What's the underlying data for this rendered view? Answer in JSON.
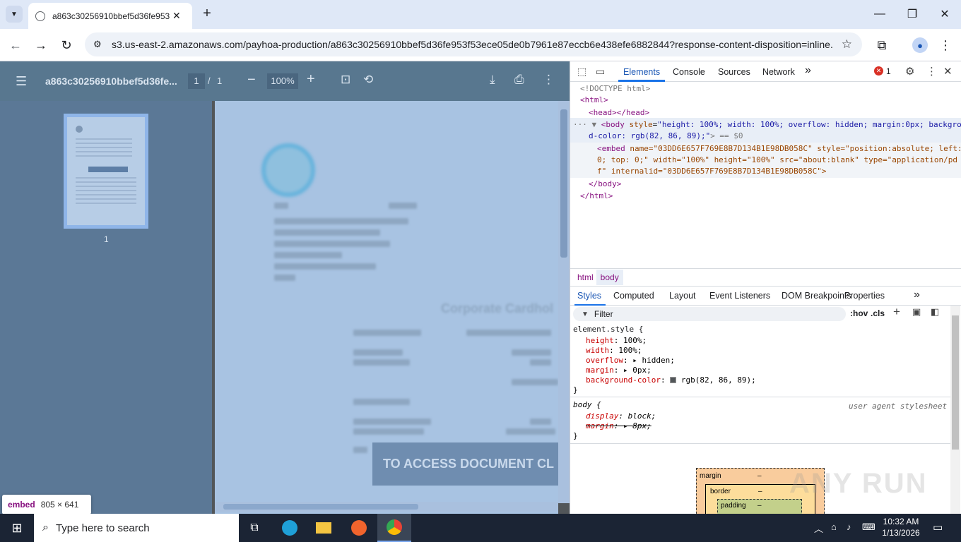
{
  "browser": {
    "tab_title": "a863c30256910bbef5d36fe953",
    "new_tab": "+",
    "url": "s3.us-east-2.amazonaws.com/payhoa-production/a863c30256910bbef5d36fe953f53ece05de0b7961e87eccb6e438efe6882844?response-content-disposition=inline..."
  },
  "pdf": {
    "filename": "a863c30256910bbef5d36fe...",
    "page_current": "1",
    "page_sep": "/",
    "page_total": "1",
    "zoom": "100%",
    "thumb_label": "1",
    "overlay_text": "TO ACCESS DOCUMENT CL",
    "doc_heading": "Corporate Cardhol"
  },
  "embed_tooltip": {
    "tag": "embed",
    "size": "805 × 641"
  },
  "devtools": {
    "tabs": [
      "Elements",
      "Console",
      "Sources",
      "Network"
    ],
    "more": "»",
    "error_count": "1",
    "dom": {
      "doctype": "<!DOCTYPE html>",
      "html_open": "<html>",
      "head": "<head></head>",
      "body_tag": "<body",
      "body_attr": "style",
      "body_val_1": "\"height: 100%; width: 100%; overflow: hidden; margin:0px; backgroun",
      "body_val_2": "d-color: rgb(82, 86, 89);\"",
      "body_end": "> == $0",
      "embed_tag": "<embed",
      "embed_line1": " name=\"03DD6E657F769E8B7D134B1E98DB058C\" style=\"position:absolute; left:",
      "embed_line2": "0; top: 0;\" width=\"100%\" height=\"100%\" src=\"about:blank\" type=\"application/pd",
      "embed_line3": "f\" internalid=\"03DD6E657F769E8B7D134B1E98DB058C\">",
      "body_close": "</body>",
      "html_close": "</html>"
    },
    "breadcrumbs": [
      "html",
      "body"
    ],
    "style_tabs": [
      "Styles",
      "Computed",
      "Layout",
      "Event Listeners",
      "DOM Breakpoints",
      "Properties"
    ],
    "filter_placeholder": "Filter",
    "hov": ":hov",
    "cls": ".cls",
    "element_style": {
      "selector": "element.style {",
      "props": [
        {
          "name": "height",
          "value": "100%;"
        },
        {
          "name": "width",
          "value": "100%;"
        },
        {
          "name": "overflow",
          "value": "hidden;"
        },
        {
          "name": "margin",
          "value": "0px;"
        },
        {
          "name": "background-color",
          "value": "rgb(82, 86, 89);"
        }
      ],
      "close": "}"
    },
    "ua_rule": {
      "selector": "body {",
      "source": "user agent stylesheet",
      "display": "display",
      "display_val": "block;",
      "margin": "margin",
      "margin_val": "8px;",
      "close": "}"
    },
    "box_model": {
      "margin": "margin",
      "border": "border",
      "padding": "padding",
      "dash": "–"
    }
  },
  "taskbar": {
    "search_placeholder": "Type here to search",
    "time": "10:32 AM",
    "date": "1/13/2026"
  },
  "watermark": "ANY RUN"
}
